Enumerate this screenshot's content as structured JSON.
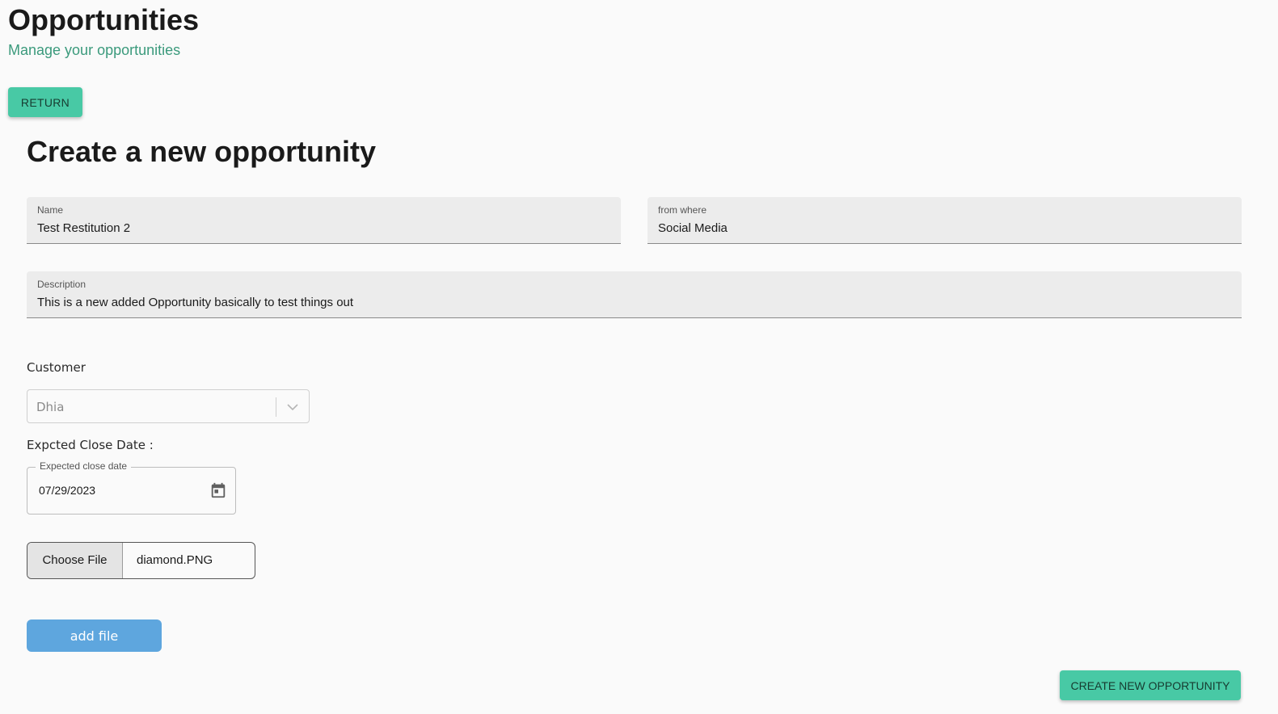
{
  "header": {
    "title": "Opportunities",
    "subtitle": "Manage your opportunities",
    "return_label": "RETURN"
  },
  "form": {
    "title": "Create a new opportunity",
    "name": {
      "label": "Name",
      "value": "Test Restitution 2"
    },
    "from_where": {
      "label": "from where",
      "value": "Social Media"
    },
    "description": {
      "label": "Description",
      "value": "This is a new added Opportunity basically to test things out"
    },
    "customer": {
      "label": "Customer",
      "selected": "Dhia",
      "icon": "chevron-down-icon"
    },
    "close_date": {
      "section_label": "Expcted Close Date :",
      "field_label": "Expected close date",
      "value": "07/29/2023",
      "icon": "calendar-icon"
    },
    "file": {
      "button_label": "Choose File",
      "filename": "diamond.PNG"
    },
    "add_file_label": "add file",
    "submit_label": "CREATE NEW OPPORTUNITY"
  },
  "colors": {
    "accent": "#48c9a5",
    "subtitle": "#3b9a7c",
    "add_file": "#5ea6de"
  }
}
